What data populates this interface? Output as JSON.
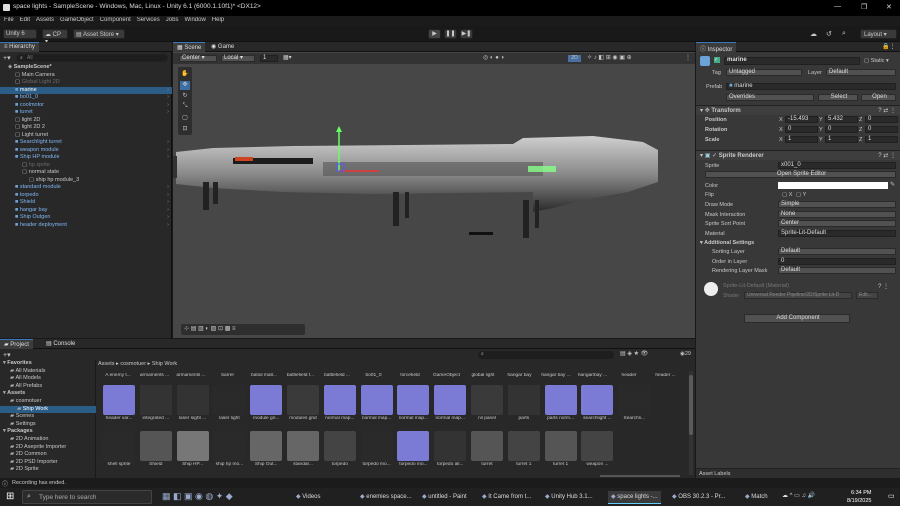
{
  "window": {
    "title": "space lights - SampleScene - Windows, Mac, Linux - Unity 6.1 (6000.1.10f1)* <DX12>",
    "controls": [
      "—",
      "❐",
      "✕"
    ]
  },
  "menu": [
    "File",
    "Edit",
    "Assets",
    "GameObject",
    "Component",
    "Services",
    "Jobs",
    "Window",
    "Help"
  ],
  "toolbar": {
    "account": "Unity 6",
    "cp": "CP",
    "asset_store": "Asset Store",
    "layout": "Layout"
  },
  "hierarchy": {
    "tab": "Hierarchy",
    "search_placeholder": "All",
    "items": [
      {
        "label": "SampleScene*",
        "indent": 0,
        "kind": "scene"
      },
      {
        "label": "Main Camera",
        "indent": 1,
        "kind": "obj"
      },
      {
        "label": "Global Light 2D",
        "indent": 1,
        "kind": "disabled"
      },
      {
        "label": "marine",
        "indent": 1,
        "kind": "prefab-sel"
      },
      {
        "label": "bo01_0",
        "indent": 1,
        "kind": "prefab"
      },
      {
        "label": "coolmotor",
        "indent": 1,
        "kind": "prefab"
      },
      {
        "label": "turret",
        "indent": 1,
        "kind": "prefab"
      },
      {
        "label": "light 2D",
        "indent": 1,
        "kind": "obj"
      },
      {
        "label": "light 2D 2",
        "indent": 1,
        "kind": "obj"
      },
      {
        "label": "Light turret",
        "indent": 1,
        "kind": "obj"
      },
      {
        "label": "Searchlight turret",
        "indent": 1,
        "kind": "prefab"
      },
      {
        "label": "weapon module",
        "indent": 1,
        "kind": "prefab"
      },
      {
        "label": "Ship HP module",
        "indent": 1,
        "kind": "prefab"
      },
      {
        "label": "hp sprite",
        "indent": 2,
        "kind": "disabled"
      },
      {
        "label": "normal state",
        "indent": 2,
        "kind": "obj"
      },
      {
        "label": "ship hp module_3",
        "indent": 3,
        "kind": "obj"
      },
      {
        "label": "standard module",
        "indent": 1,
        "kind": "prefab"
      },
      {
        "label": "torpedo",
        "indent": 1,
        "kind": "prefab"
      },
      {
        "label": "Shield",
        "indent": 1,
        "kind": "prefab"
      },
      {
        "label": "hangar bay",
        "indent": 1,
        "kind": "prefab"
      },
      {
        "label": "Ship Outgen",
        "indent": 1,
        "kind": "prefab"
      },
      {
        "label": "header deployment",
        "indent": 1,
        "kind": "prefab"
      }
    ]
  },
  "scene": {
    "tabs": [
      "Scene",
      "Game"
    ],
    "pivot": "Center",
    "space": "Local",
    "grid": "1",
    "mode_2d": "2D"
  },
  "inspector": {
    "tab": "Inspector",
    "name": "marine",
    "static": "Static",
    "tag_label": "Tag",
    "tag": "Untagged",
    "layer_label": "Layer",
    "layer": "Default",
    "prefab_label": "Prefab",
    "prefab": "marine",
    "overrides": "Overrides",
    "select": "Select",
    "open": "Open",
    "transform": {
      "title": "Transform",
      "position": {
        "label": "Position",
        "x": "-15.493",
        "y": "5.432",
        "z": "0"
      },
      "rotation": {
        "label": "Rotation",
        "x": "0",
        "y": "0",
        "z": "0"
      },
      "scale": {
        "label": "Scale",
        "x": "1",
        "y": "1",
        "z": "1"
      }
    },
    "sprite_renderer": {
      "title": "Sprite Renderer",
      "sprite_label": "Sprite",
      "sprite": "x001_0",
      "open_editor": "Open Sprite Editor",
      "color_label": "Color",
      "flip_label": "Flip",
      "flip_x": "X",
      "flip_y": "Y",
      "draw_mode_label": "Draw Mode",
      "draw_mode": "Simple",
      "mask_label": "Mask Interaction",
      "mask": "None",
      "sort_point_label": "Sprite Sort Point",
      "sort_point": "Center",
      "material_label": "Material",
      "material": "Sprite-Lit-Default",
      "additional": "Additional Settings",
      "sorting_layer_label": "Sorting Layer",
      "sorting_layer": "Default",
      "order_label": "Order in Layer",
      "order": "0",
      "rendering_mask_label": "Rendering Layer Mask",
      "rendering_mask": "Default"
    },
    "material_block": {
      "name": "Sprite-Lit-Default (Material)",
      "shader_label": "Shader",
      "shader": "Universal Render Pipeline/2D/Sprite-Lit-D",
      "edit": "Edit..."
    },
    "add_component": "Add Component",
    "asset_labels": "Asset Labels"
  },
  "project": {
    "tabs": [
      "Project",
      "Console"
    ],
    "breadcrumb": [
      "Assets",
      "cosmotuer",
      "Ship Work"
    ],
    "count": "29",
    "tree": [
      {
        "label": "Favorites",
        "indent": 0,
        "bold": true
      },
      {
        "label": "All Materials",
        "indent": 1
      },
      {
        "label": "All Models",
        "indent": 1
      },
      {
        "label": "All Prefabs",
        "indent": 1
      },
      {
        "label": "Assets",
        "indent": 0,
        "bold": true
      },
      {
        "label": "cosmotuer",
        "indent": 1
      },
      {
        "label": "Ship Work",
        "indent": 2,
        "sel": true
      },
      {
        "label": "Scenes",
        "indent": 1
      },
      {
        "label": "Settings",
        "indent": 1
      },
      {
        "label": "Packages",
        "indent": 0,
        "bold": true
      },
      {
        "label": "2D Animation",
        "indent": 1
      },
      {
        "label": "2D Aseprite Importer",
        "indent": 1
      },
      {
        "label": "2D Common",
        "indent": 1
      },
      {
        "label": "2D PSD Importer",
        "indent": 1
      },
      {
        "label": "2D Sprite",
        "indent": 1
      }
    ],
    "top_labels": [
      "A enemy t...",
      "armaments ...",
      "armaments ...",
      "barrel",
      "batoil matl...",
      "battlefield f...",
      "battlefield ...",
      "bo01_0",
      "forcefield",
      "GameObject",
      "global light",
      "hangar bay",
      "hangar bay ...",
      "hangar/bay ...",
      "header",
      "header ..."
    ],
    "row1": [
      "header var...",
      "integrated ...",
      "laser sight ...",
      "laser light",
      "module gri...",
      "modules grid",
      "normal map...",
      "normal map...",
      "normal map...",
      "normal map...",
      "nil panel",
      "parts",
      "parts norm...",
      "searchlight ...",
      "Searchli..."
    ],
    "row2": [
      "shell sprite",
      "Shield",
      "Ship HP...",
      "ship hp mo...",
      "Ship Out...",
      "standar...",
      "torpedo",
      "torpedo mo...",
      "torpedo mo...",
      "torpedo all...",
      "turret",
      "turret 1",
      "turret 1",
      "weapon ..."
    ],
    "status": "Recording has ended."
  },
  "taskbar": {
    "search": "Type here to search",
    "apps": [
      "Videos",
      "enemies space...",
      "untitled - Paint",
      "It Came from t...",
      "Unity Hub 3.1...",
      "space lights -...",
      "OBS 30.2.3 - Pr...",
      "Match"
    ],
    "time": "6:34 PM",
    "date": "8/19/2025"
  }
}
